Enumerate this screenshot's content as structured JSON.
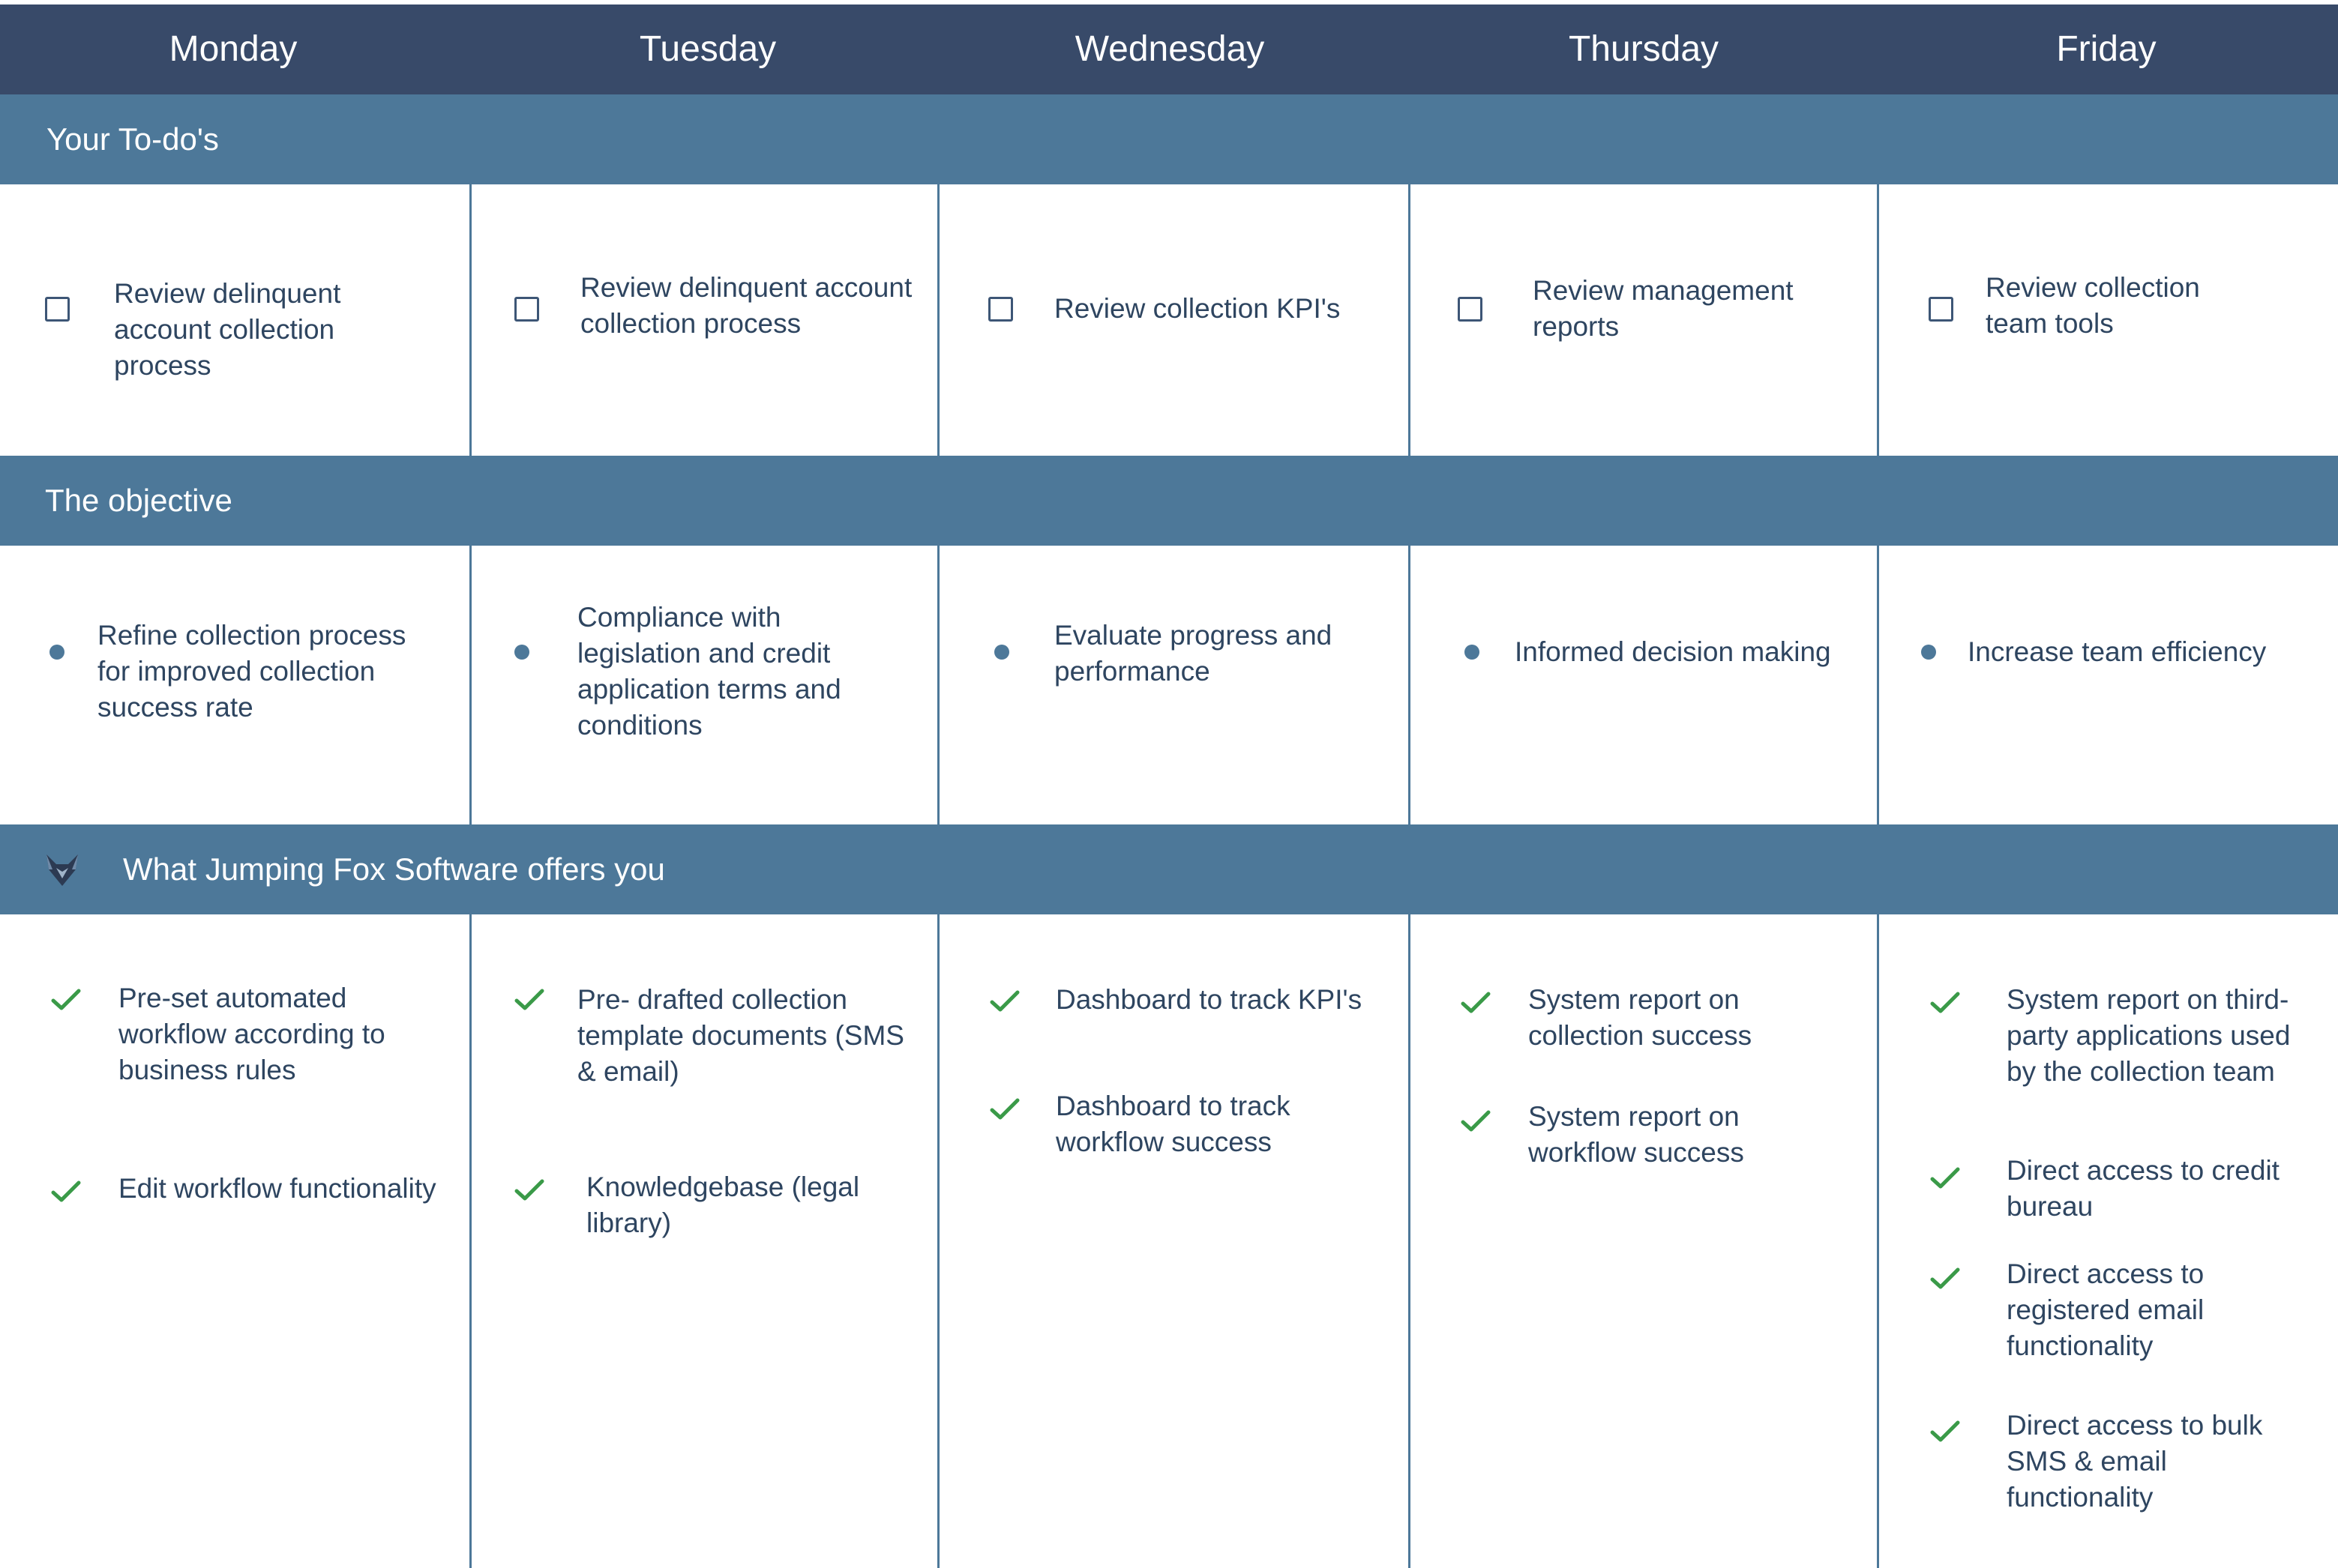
{
  "days": [
    "Monday",
    "Tuesday",
    "Wednesday",
    "Thursday",
    "Friday"
  ],
  "sections": {
    "todos": "Your To-do's",
    "objective": "The objective",
    "offers": "What Jumping Fox Software offers you"
  },
  "todos": [
    "Review delinquent account collection process",
    "Review delinquent account collection process",
    "Review collection KPI's",
    "Review management reports",
    "Review collection team tools"
  ],
  "objectives": [
    "Refine collection process for improved collection success rate",
    "Compliance with legislation and credit application terms and conditions",
    "Evaluate progress and performance",
    "Informed decision making",
    "Increase team efficiency"
  ],
  "offers": {
    "monday": [
      "Pre-set automated workflow according to business rules",
      "Edit workflow functionality"
    ],
    "tuesday": [
      "Pre- drafted collection template documents (SMS & email)",
      "Knowledgebase (legal library)"
    ],
    "wednesday": [
      "Dashboard to track KPI's",
      "Dashboard to track workflow success"
    ],
    "thursday": [
      "System report on collection success",
      "System report on workflow success"
    ],
    "friday": [
      "System report on third-party applications used by the collection team",
      "Direct access to credit bureau",
      "Direct access to registered email functionality",
      "Direct access to bulk SMS & email functionality"
    ]
  },
  "icons": {
    "todo": "checkbox-icon",
    "objective": "bullet-icon",
    "offer": "checkmark-icon",
    "brand": "fox-logo-icon"
  },
  "colors": {
    "day_header": "#384a69",
    "band": "#4d7899",
    "text": "#2e4560",
    "check": "#3a9a48"
  }
}
